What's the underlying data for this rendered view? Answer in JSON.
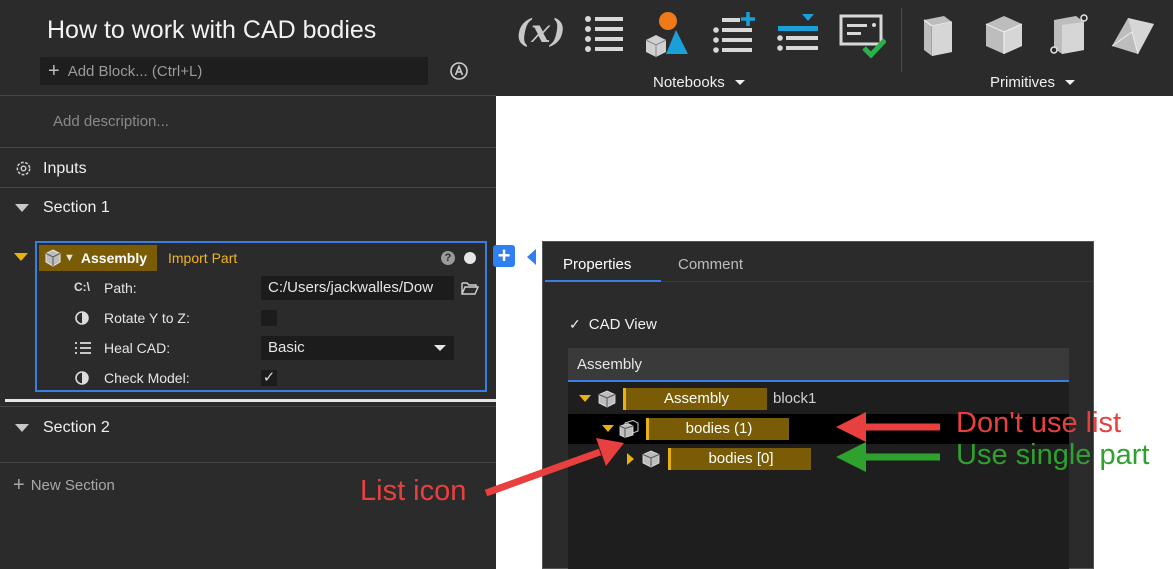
{
  "notebook": {
    "title": "How to work with CAD bodies",
    "add_block_placeholder": "Add Block... (Ctrl+L)",
    "description_placeholder": "Add description...",
    "inputs_label": "Inputs",
    "sections": [
      {
        "label": "Section 1"
      },
      {
        "label": "Section 2"
      }
    ],
    "new_section_label": "New Section"
  },
  "block": {
    "name": "Assembly",
    "type": "Import Part",
    "help_label": "?",
    "properties": {
      "path": {
        "icon_text": "C:\\",
        "label": "Path:",
        "value": "C:/Users/jackwalles/Dow"
      },
      "rotate": {
        "label": "Rotate Y to Z:",
        "checked": false
      },
      "heal": {
        "label": "Heal CAD:",
        "value": "Basic"
      },
      "check": {
        "label": "Check Model:",
        "checked": true,
        "mark": "✓"
      }
    }
  },
  "toolbar": {
    "variable_label": "(x)",
    "groups": [
      {
        "label": "Notebooks"
      },
      {
        "label": "Primitives"
      }
    ]
  },
  "properties_panel": {
    "tabs": [
      "Properties",
      "Comment"
    ],
    "active_tab": "Properties",
    "cad_view": {
      "label": "CAD View",
      "checked": true,
      "mark": "✓"
    },
    "tree_header": "Assembly",
    "tree": [
      {
        "label": "Assembly",
        "extra": "block1"
      },
      {
        "label": "bodies (1)"
      },
      {
        "label": "bodies [0]"
      }
    ]
  },
  "annotations": {
    "dont_use": {
      "text": "Don't use list",
      "color": "#e8403e"
    },
    "use_single": {
      "text": "Use single part",
      "color": "#2fa12f"
    },
    "list_icon": {
      "text": "List icon",
      "color": "#e8403e"
    }
  },
  "colors": {
    "accent_blue": "#3a7ee0",
    "gold": "#e8b10c",
    "node_bg": "#7a5c06",
    "panel_bg": "#2b2b2b"
  }
}
